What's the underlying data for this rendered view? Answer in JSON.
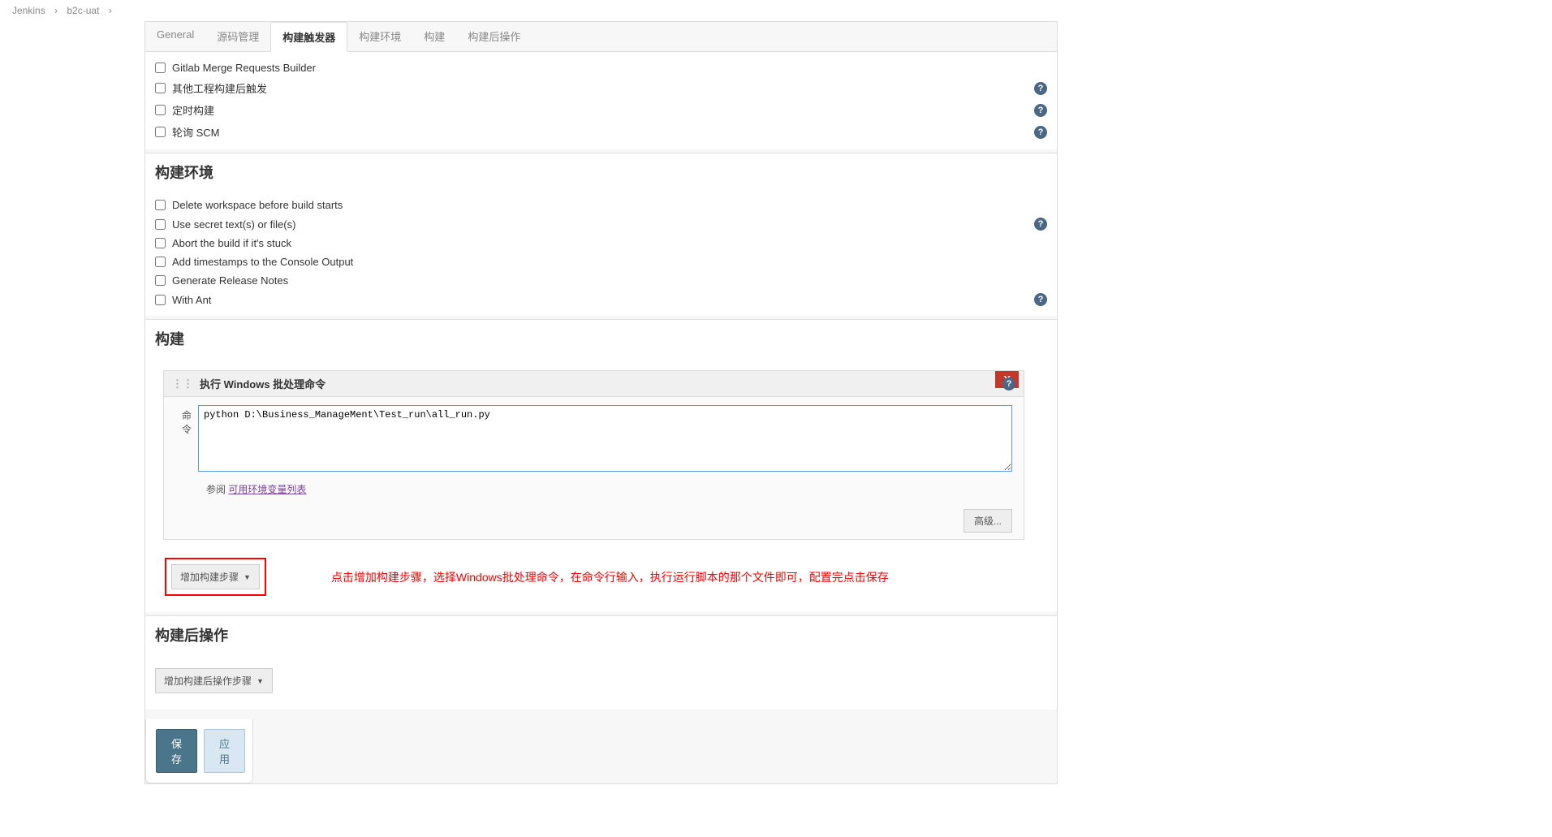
{
  "breadcrumbs": {
    "root": "Jenkins",
    "job": "b2c-uat"
  },
  "tabs": {
    "general": "General",
    "scm": "源码管理",
    "triggers": "构建触发器",
    "env": "构建环境",
    "build": "构建",
    "post": "构建后操作"
  },
  "triggers": {
    "gitlab_mr": "Gitlab Merge Requests Builder",
    "other_builds": "其他工程构建后触发",
    "timer": "定时构建",
    "poll_scm": "轮询 SCM"
  },
  "env": {
    "heading": "构建环境",
    "delete_ws": "Delete workspace before build starts",
    "secret": "Use secret text(s) or file(s)",
    "abort": "Abort the build if it's stuck",
    "timestamps": "Add timestamps to the Console Output",
    "release_notes": "Generate Release Notes",
    "with_ant": "With Ant"
  },
  "build": {
    "heading": "构建",
    "step_title": "执行 Windows 批处理命令",
    "cmd_label": "命令",
    "cmd_value": "python D:\\Business_ManageMent\\Test_run\\all_run.py",
    "refer_prefix": "参阅 ",
    "refer_link": "可用环境变量列表",
    "advanced": "高级...",
    "add_step": "增加构建步骤",
    "annotation": "点击增加构建步骤，选择Windows批处理命令，在命令行输入，执行运行脚本的那个文件即可，配置完点击保存"
  },
  "post": {
    "heading": "构建后操作",
    "add_step": "增加构建后操作步骤"
  },
  "footer": {
    "save": "保存",
    "apply": "应用"
  }
}
